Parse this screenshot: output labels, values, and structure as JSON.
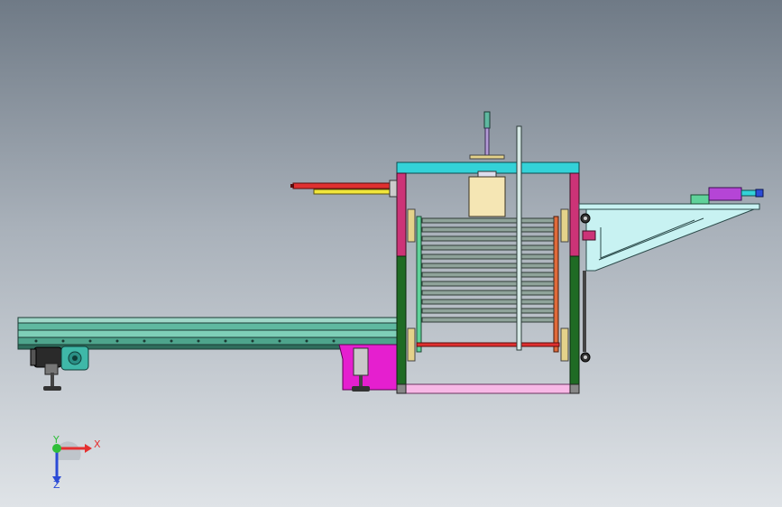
{
  "view": {
    "background_top": "#6f7a86",
    "background_bottom": "#dfe3e7"
  },
  "triad": {
    "x_label": "X",
    "y_label": "Y",
    "z_label": "Z",
    "x_color": "#e53030",
    "y_color": "#2fbf3a",
    "z_color": "#2b4bd6"
  },
  "parts": {
    "conveyor": {
      "color": "#5fb8a0"
    },
    "top_beam": {
      "color": "#33d2d8"
    },
    "columns_upper": {
      "color": "#cc3377"
    },
    "columns_lower": {
      "color": "#1f6b24"
    },
    "rollers": {
      "color": "#6b7f74"
    },
    "red_cylinder": {
      "color": "#e03030"
    },
    "yellow_rod": {
      "color": "#f2e63a"
    },
    "counterweight": {
      "color": "#f5e6b4"
    },
    "bracket_arm": {
      "color": "#c8f2f2"
    },
    "magenta_pit": {
      "color": "#e51fcf"
    },
    "bottom_plate": {
      "color": "#f7b8e6"
    },
    "motor": {
      "color": "#222222"
    }
  }
}
